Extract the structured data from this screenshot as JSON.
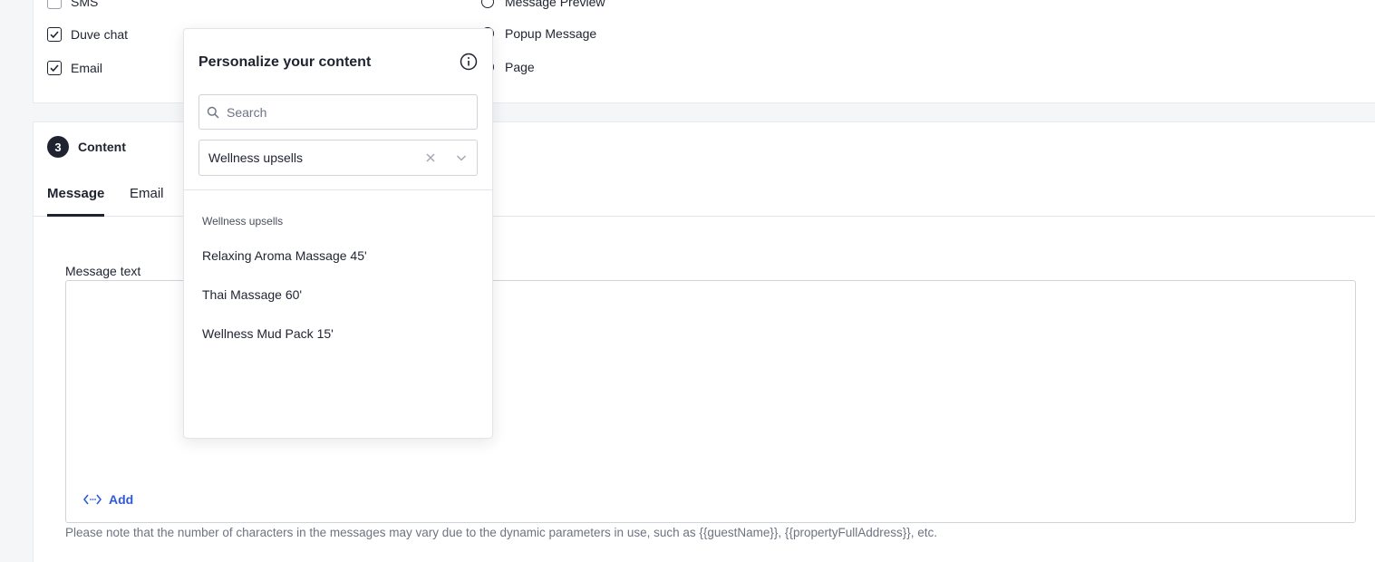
{
  "channels": {
    "sms": {
      "label": "SMS",
      "checked": false
    },
    "duve_chat": {
      "label": "Duve chat",
      "checked": true
    },
    "email": {
      "label": "Email",
      "checked": true
    }
  },
  "display_type": {
    "message_preview": "Message Preview",
    "popup_message": "Popup Message",
    "page": "Page"
  },
  "content_section": {
    "step_number": "3",
    "title": "Content",
    "tabs": [
      {
        "label": "Message",
        "active": true
      },
      {
        "label": "Email",
        "active": false
      }
    ],
    "message_label": "Message text",
    "message_value": "",
    "add_label": "Add",
    "note": "Please note that the number of characters in the messages may vary due to the dynamic parameters in use, such as {{guestName}}, {{propertyFullAddress}}, etc."
  },
  "popover": {
    "title": "Personalize your content",
    "search_placeholder": "Search",
    "selected_category": "Wellness upsells",
    "group_label": "Wellness upsells",
    "options": [
      "Relaxing Aroma Massage 45'",
      "Thai Massage 60'",
      "Wellness Mud Pack 15'"
    ]
  },
  "colors": {
    "text": "#1f2330",
    "accent": "#2f5bd8",
    "muted": "#6d7380",
    "border": "#cfd3da"
  },
  "icons": [
    "check-icon",
    "info-icon",
    "search-icon",
    "clear-icon",
    "chevron-down-icon",
    "code-icon",
    "resize-icon"
  ]
}
